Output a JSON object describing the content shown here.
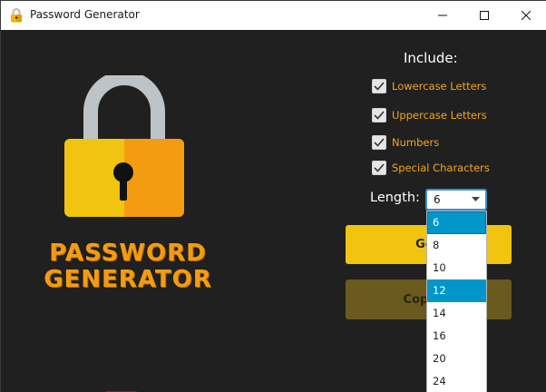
{
  "window": {
    "title": "Password Generator",
    "icon": "lock-icon"
  },
  "controls": {
    "minimize": "minimize-icon",
    "maximize": "maximize-icon",
    "close": "close-icon"
  },
  "brand": {
    "line1": "PASSWORD",
    "line2": "GENERATOR",
    "accent": "#f39c12"
  },
  "options": {
    "title": "Include:",
    "items": [
      {
        "label": "Lowercase Letters",
        "checked": true
      },
      {
        "label": "Uppercase Letters",
        "checked": true
      },
      {
        "label": "Numbers",
        "checked": true
      },
      {
        "label": "Special Characters",
        "checked": true
      }
    ]
  },
  "length": {
    "label": "Length:",
    "value": "6",
    "options": [
      "6",
      "8",
      "10",
      "12",
      "14",
      "16",
      "20",
      "24"
    ],
    "highlighted": "12"
  },
  "buttons": {
    "generate": "Gen",
    "copy": "Copy to"
  },
  "colors": {
    "background": "#202020",
    "generate": "#f1c40f",
    "copy": "#6b5a1e",
    "option_text": "#f3a51d",
    "selection": "#0096c9"
  }
}
